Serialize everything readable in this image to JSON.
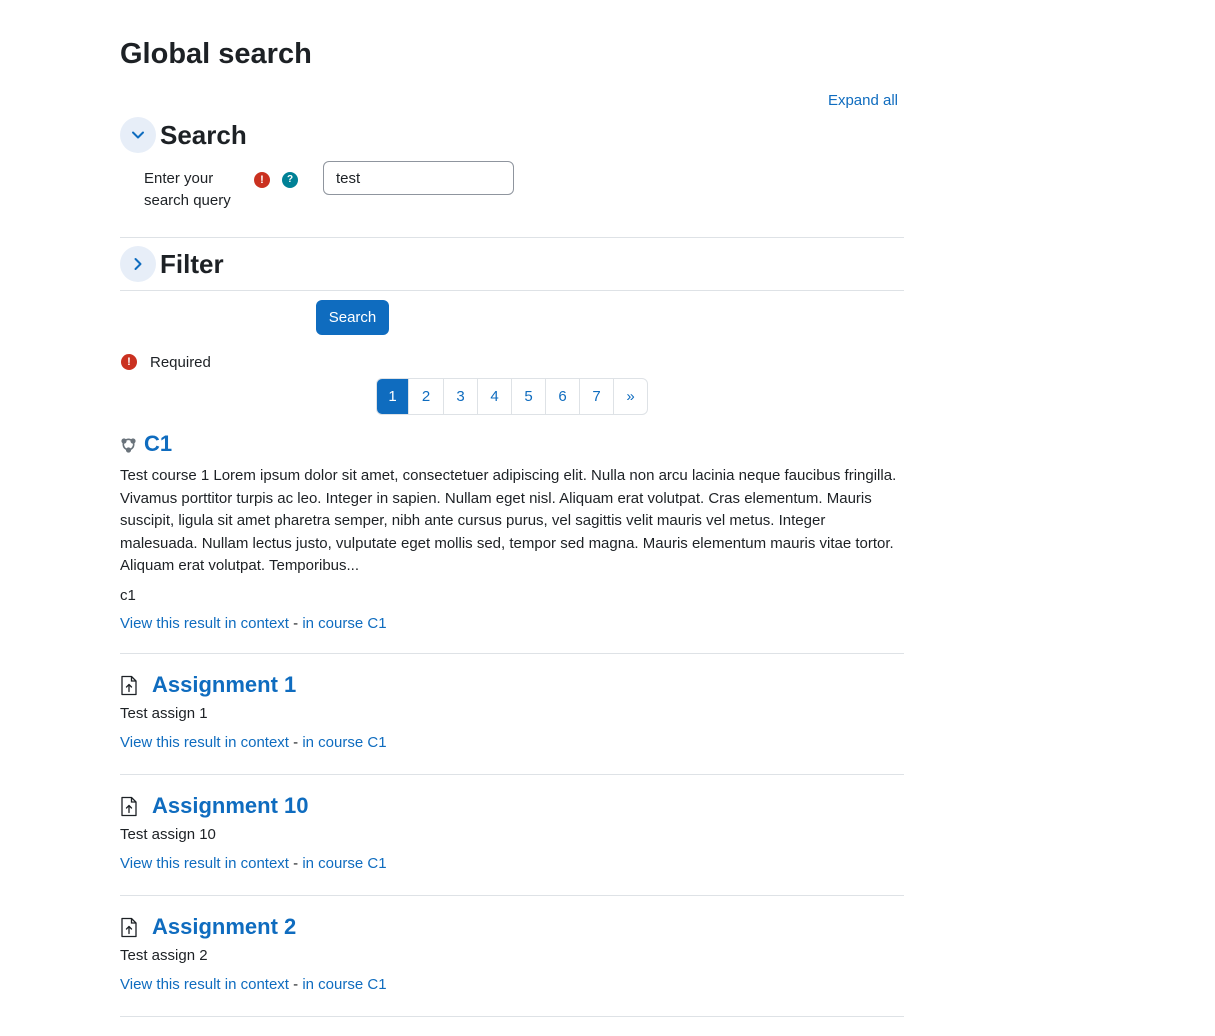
{
  "page": {
    "title": "Global search"
  },
  "expand_all": "Expand all",
  "search_section": {
    "title": "Search",
    "query_label": "Enter your search query",
    "query_value": "test"
  },
  "filter_section": {
    "title": "Filter"
  },
  "search_button": "Search",
  "required_note": "Required",
  "pagination": {
    "pages": [
      "1",
      "2",
      "3",
      "4",
      "5",
      "6",
      "7"
    ],
    "next": "»",
    "current": "1"
  },
  "results": [
    {
      "title": "C1",
      "icon": "course-icon",
      "description": "Test course 1 Lorem ipsum dolor sit amet, consectetuer adipiscing elit. Nulla non arcu lacinia neque faucibus fringilla. Vivamus porttitor turpis ac leo. Integer in sapien. Nullam eget nisl. Aliquam erat volutpat. Cras elementum. Mauris suscipit, ligula sit amet pharetra semper, nibh ante cursus purus, vel sagittis velit mauris vel metus. Integer malesuada. Nullam lectus justo, vulputate eget mollis sed, tempor sed magna. Mauris elementum mauris vitae tortor. Aliquam erat volutpat. Temporibus...",
      "extra": "c1",
      "context_link": "View this result in context",
      "separator": "-",
      "course_link": "in course C1"
    },
    {
      "title": "Assignment 1",
      "icon": "assignment-icon",
      "description": "Test assign 1",
      "context_link": "View this result in context",
      "separator": "-",
      "course_link": "in course C1"
    },
    {
      "title": "Assignment 10",
      "icon": "assignment-icon",
      "description": "Test assign 10",
      "context_link": "View this result in context",
      "separator": "-",
      "course_link": "in course C1"
    },
    {
      "title": "Assignment 2",
      "icon": "assignment-icon",
      "description": "Test assign 2",
      "context_link": "View this result in context",
      "separator": "-",
      "course_link": "in course C1"
    }
  ],
  "colors": {
    "link": "#0f6cbf",
    "required": "#ca3120",
    "help": "#008196",
    "text": "#1d2125"
  }
}
